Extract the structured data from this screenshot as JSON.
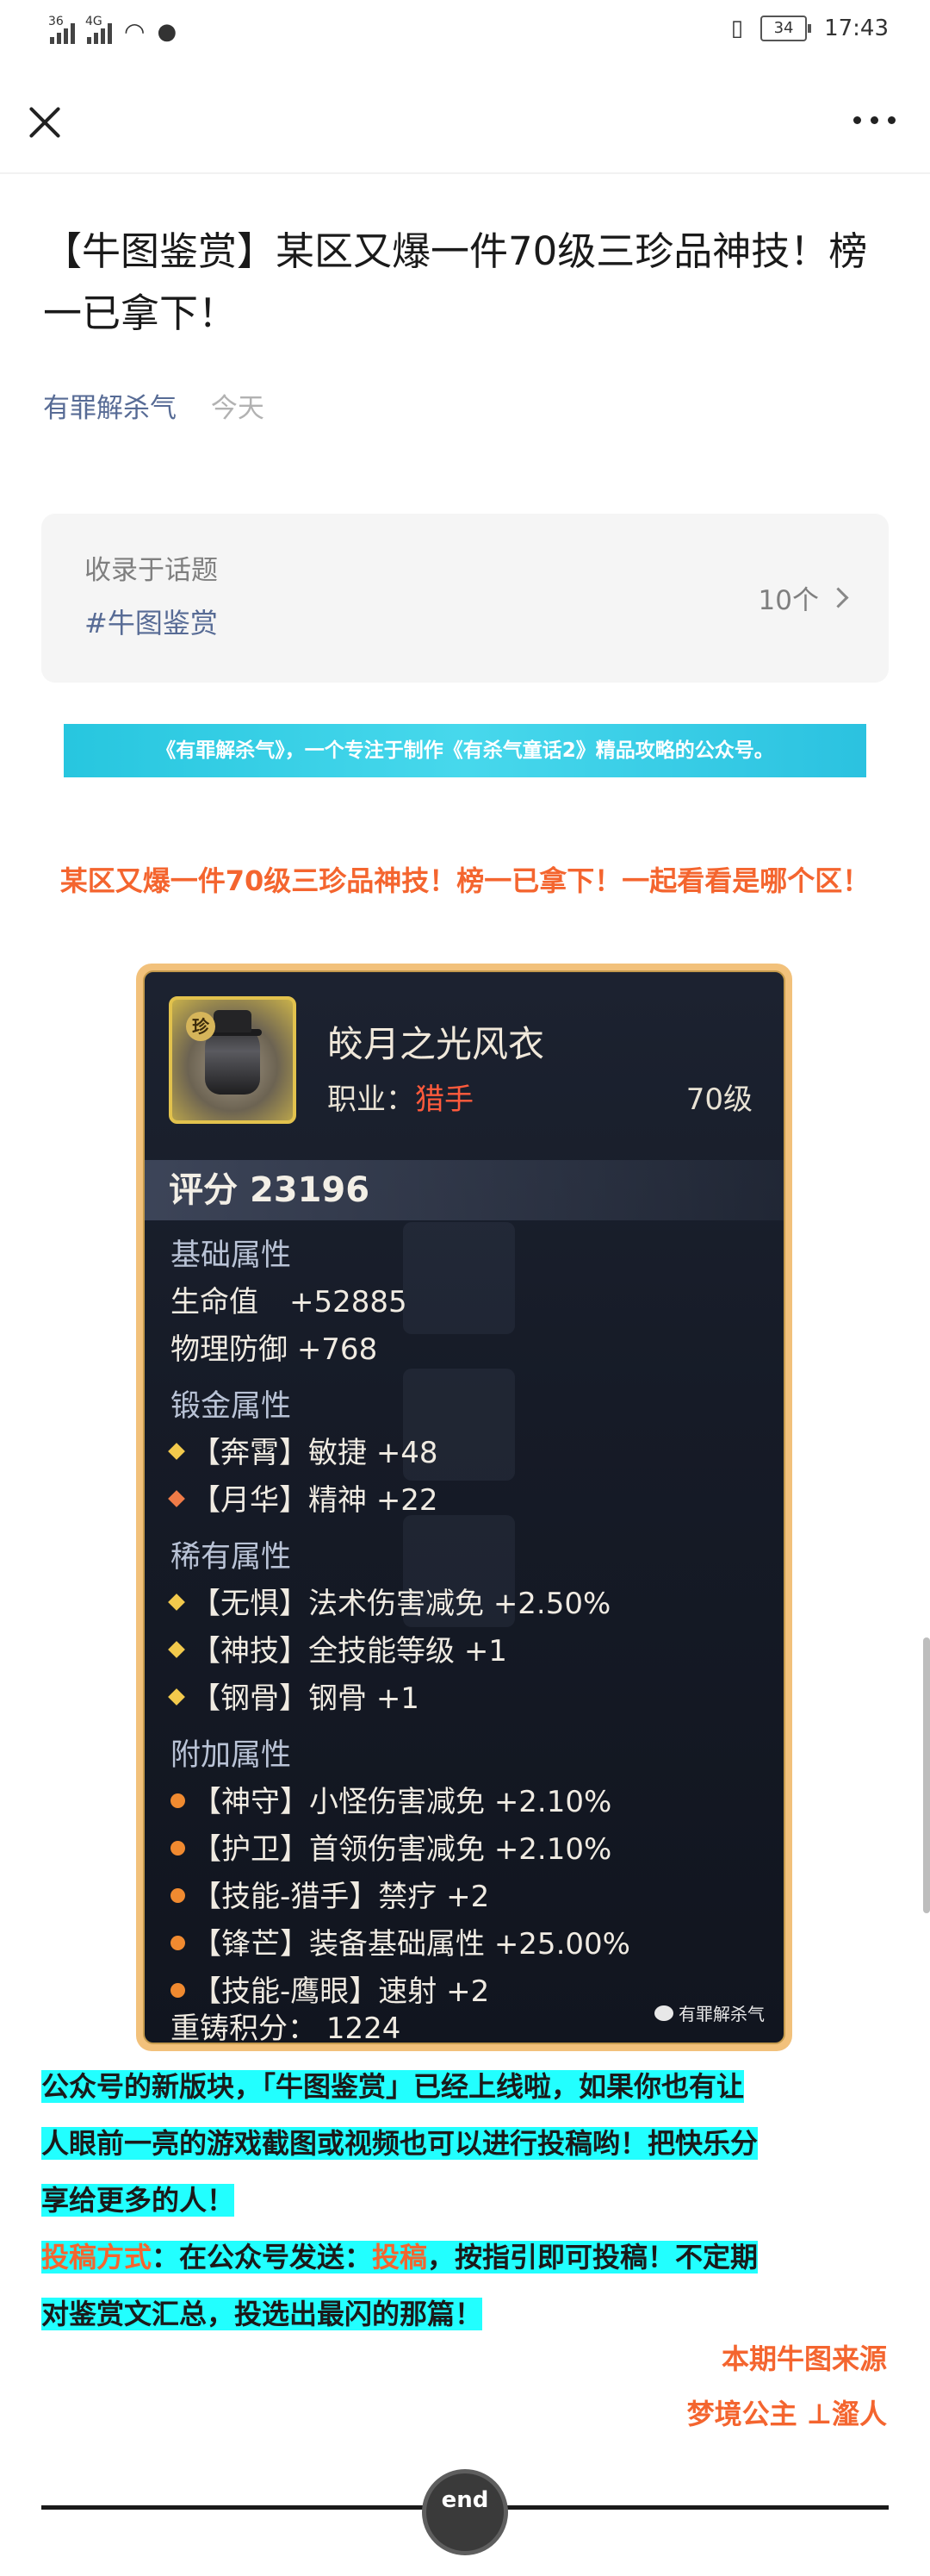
{
  "status_bar": {
    "sim1": "36",
    "sim2": "4G",
    "battery": "34",
    "time": "17:43"
  },
  "article": {
    "title": "【牛图鉴赏】某区又爆一件70级三珍品神技！榜一已拿下！",
    "author": "有罪解杀气",
    "date": "今天"
  },
  "topic": {
    "label": "收录于话题",
    "tag": "#牛图鉴赏",
    "count": "10个"
  },
  "banner": "《有罪解杀气》，一个专注于制作《有杀气童话2》精品攻略的公众号。",
  "headline": "某区又爆一件70级三珍品神技！榜一已拿下！一起看看是哪个区！",
  "item_card": {
    "badge": "珍",
    "name": "皎月之光风衣",
    "job_label": "职业：",
    "job": "猎手",
    "level": "70级",
    "score_label": "评分",
    "score": "23196",
    "base_title": "基础属性",
    "base": [
      {
        "name": "生命值",
        "value": "+52885"
      },
      {
        "name": "物理防御",
        "value": "+768"
      }
    ],
    "forge_title": "锻金属性",
    "forge": [
      {
        "tag": "【奔霄】",
        "name": "敏捷",
        "value": "+48",
        "marker": "gold"
      },
      {
        "tag": "【月华】",
        "name": "精神",
        "value": "+22",
        "marker": "orange"
      }
    ],
    "rare_title": "稀有属性",
    "rare": [
      {
        "tag": "【无惧】",
        "name": "法术伤害减免",
        "value": "+2.50%"
      },
      {
        "tag": "【神技】",
        "name": "全技能等级",
        "value": "+1"
      },
      {
        "tag": "【钢骨】",
        "name": "钢骨",
        "value": "+1"
      }
    ],
    "extra_title": "附加属性",
    "extra": [
      {
        "tag": "【神守】",
        "name": "小怪伤害减免",
        "value": "+2.10%"
      },
      {
        "tag": "【护卫】",
        "name": "首领伤害减免",
        "value": "+2.10%"
      },
      {
        "tag": "【技能-猎手】",
        "name": "禁疗",
        "value": "+2"
      },
      {
        "tag": "【锋芒】",
        "name": "装备基础属性",
        "value": "+25.00%"
      },
      {
        "tag": "【技能-鹰眼】",
        "name": "速射",
        "value": "+2"
      }
    ],
    "recast_label": "重铸积分：",
    "recast": "1224",
    "watermark": "有罪解杀气"
  },
  "promo": {
    "line1": "公众号的新版块，「牛图鉴赏」已经上线啦，如果你也有让",
    "line2": "人眼前一亮的游戏截图或视频也可以进行投稿哟！把快乐分",
    "line3": "享给更多的人！",
    "method_label": "投稿方式",
    "method_mid": "：在公众号发送：",
    "method_keyword": "投稿",
    "method_rest": "，按指引即可投稿！不定期",
    "line5": "对鉴赏文汇总，投选出最闪的那篇！"
  },
  "credit": {
    "title": "本期牛图来源",
    "source": "梦境公主 ⊥瀣人"
  },
  "end_label": "end"
}
